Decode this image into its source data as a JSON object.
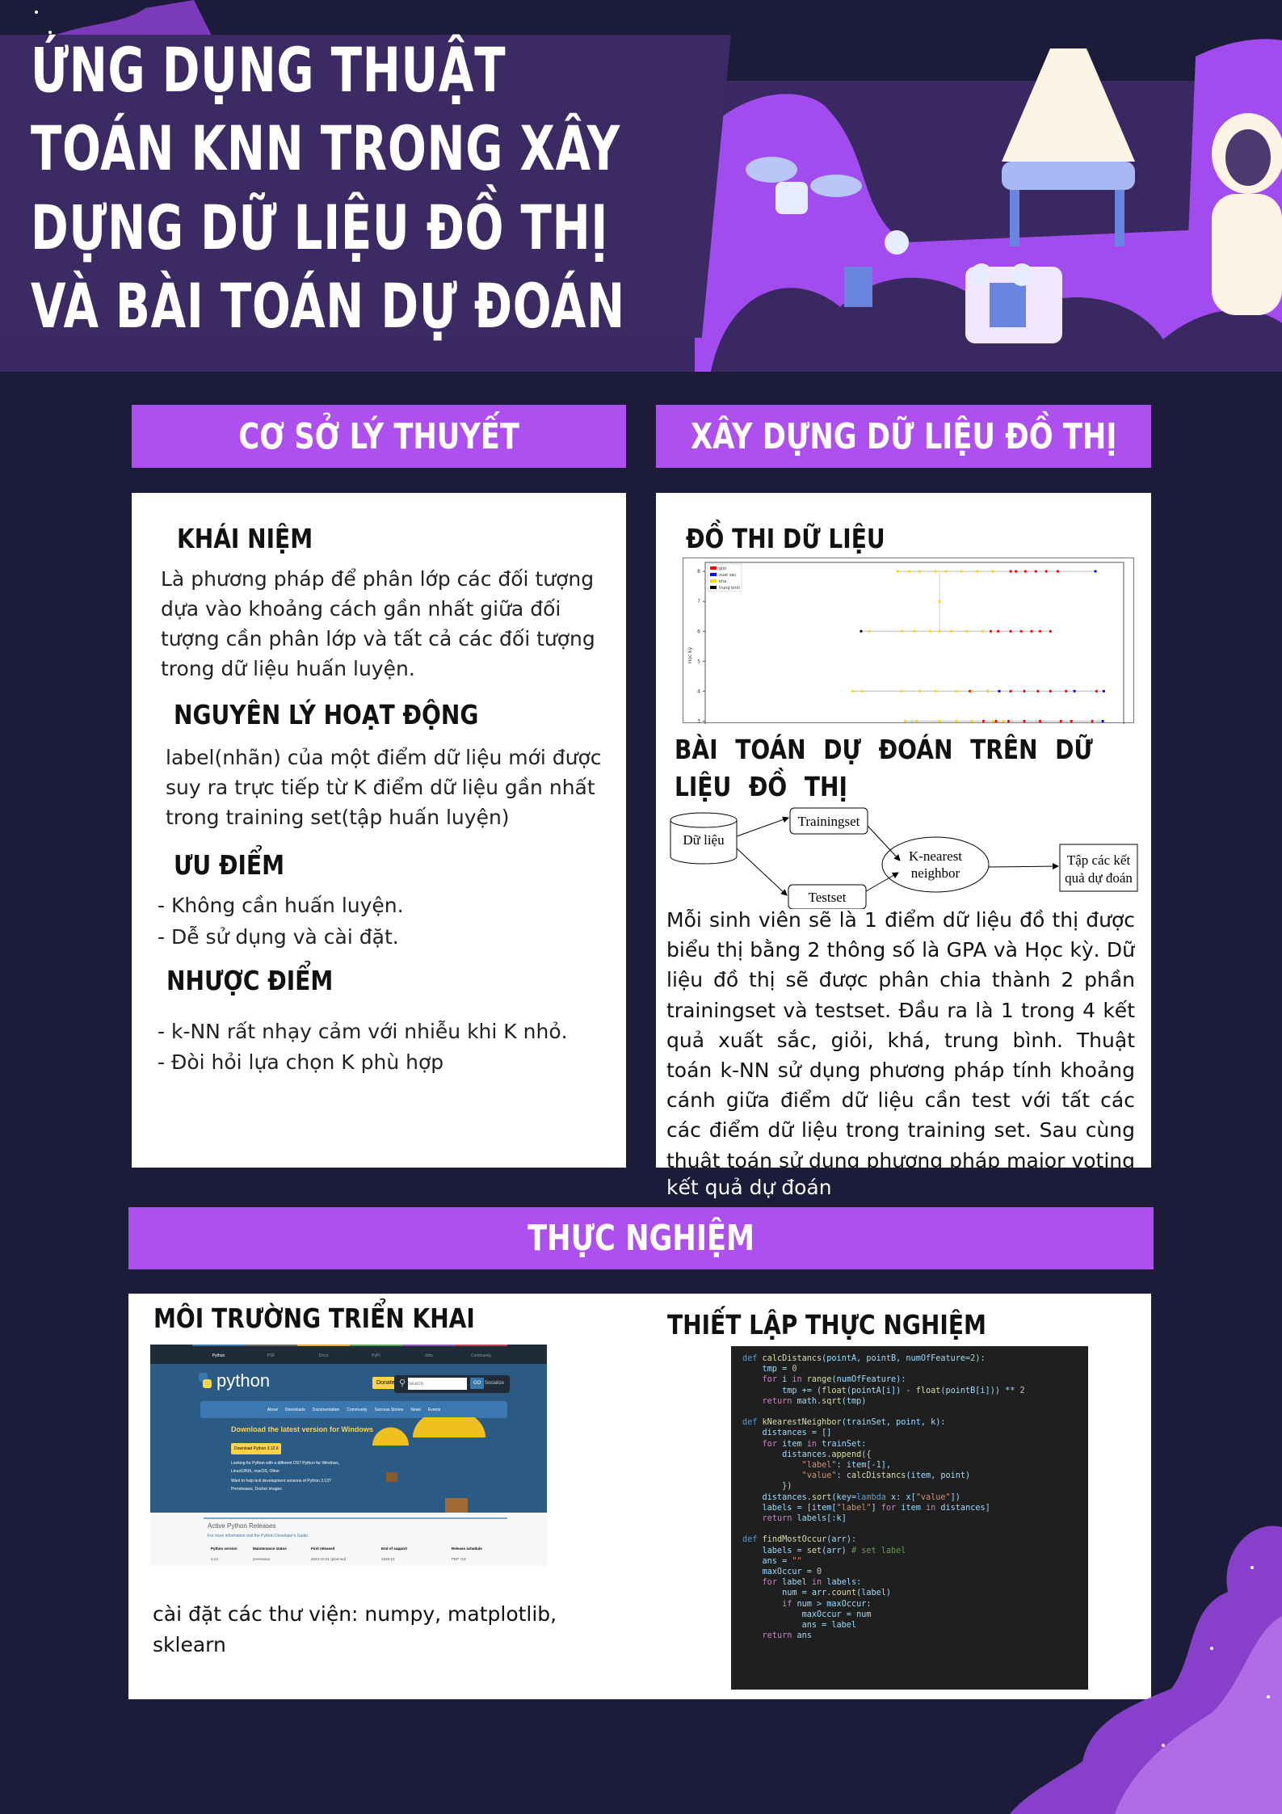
{
  "title": {
    "lines": [
      "Ứng dụng thuật",
      "toán KNN trong xây",
      "dựng dữ liệu đồ thị",
      "và bài toán dự đoán"
    ]
  },
  "colors": {
    "background": "#1c1b39",
    "accent": "#ae4ff0",
    "header_band": "#3b2a63",
    "panel": "#ffffff"
  },
  "theory": {
    "header": "Cơ  sở lý thuyết",
    "concept": {
      "heading": "Khái niệm",
      "text": "Là phương pháp để phân lớp các đối tượng dựa vào khoảng cách gần nhất giữa đối tượng cần phân lớp và tất cả các đối tượng trong dữ liệu huấn luyện."
    },
    "principle": {
      "heading": "Nguyên lý hoạt động",
      "text": "label(nhãn) của một điểm dữ liệu mới được suy ra trực tiếp từ K điểm dữ liệu gần nhất trong training set(tập huấn luyện)"
    },
    "pros": {
      "heading": "Ưu điểm",
      "items": [
        "- Không cần huấn luyện.",
        "- Dễ sử dụng và cài đặt."
      ]
    },
    "cons": {
      "heading": "Nhược điểm",
      "items": [
        "- k-NN rất nhạy cảm với nhiễu khi K nhỏ.",
        "- Đòi hỏi lựa chọn K phù hợp"
      ]
    }
  },
  "graph": {
    "header": "Xây dựng dữ liệu đồ thị",
    "chart_heading": "Đồ thi dữ liệu",
    "problem_heading": "Bài toán dự đoán trên dữ liệu đồ thị",
    "diagram": {
      "data": "Dữ liệu",
      "train": "Trainingset",
      "test": "Testset",
      "knn_line1": "K-nearest",
      "knn_line2": "neighbor",
      "out_line1": "Tập các kết",
      "out_line2": "quả dự đoán"
    },
    "body": "Mỗi sinh viên sẽ là 1 điểm dữ liệu đồ thị được biểu thị bằng 2 thông số là GPA và Học kỳ. Dữ liệu đồ thị sẽ được phân chia thành 2 phần trainingset và testset. Đầu ra là 1 trong 4 kết quả xuất sắc, giỏi, khá, trung bình. Thuật toán k-NN sử dụng phương pháp tính khoảng cánh giữa điểm dữ liệu cần test với tất các các điểm dữ liệu trong training set. Sau cùng thuật toán sử dụng phương pháp major voting để cho ra",
    "body_overflow": "kết quả dự đoán"
  },
  "chart_data": {
    "type": "scatter",
    "ylabel": "Học kỳ",
    "yticks": [
      "3",
      "4",
      "5",
      "6",
      "7",
      "8"
    ],
    "ylim": [
      2.5,
      8.3
    ],
    "xlim": [
      0,
      4
    ],
    "legend_position": "top-left",
    "series": [
      {
        "name": "gioi",
        "color": "#ff0000",
        "points": [
          [
            2.92,
            8
          ],
          [
            2.97,
            8
          ],
          [
            3.06,
            8
          ],
          [
            3.16,
            8
          ],
          [
            3.26,
            8
          ],
          [
            3.37,
            8
          ],
          [
            2.73,
            6
          ],
          [
            2.8,
            6
          ],
          [
            2.92,
            6
          ],
          [
            3.02,
            6
          ],
          [
            3.12,
            6
          ],
          [
            3.2,
            6
          ],
          [
            3.3,
            6
          ],
          [
            2.53,
            4
          ],
          [
            2.7,
            4
          ],
          [
            2.92,
            4
          ],
          [
            3.05,
            4
          ],
          [
            3.18,
            4
          ],
          [
            3.3,
            4
          ],
          [
            3.45,
            4
          ],
          [
            3.74,
            4
          ],
          [
            2.66,
            3
          ],
          [
            2.78,
            3
          ],
          [
            2.9,
            3
          ],
          [
            3.05,
            3
          ],
          [
            3.2,
            3
          ],
          [
            3.4,
            3
          ],
          [
            3.5,
            3
          ],
          [
            3.7,
            3
          ]
        ]
      },
      {
        "name": "xuat sac",
        "color": "#0000ff",
        "points": [
          [
            3.73,
            8
          ],
          [
            2.81,
            4
          ],
          [
            3.53,
            4
          ],
          [
            3.81,
            4
          ],
          [
            3.8,
            3
          ]
        ]
      },
      {
        "name": "kha",
        "color": "#ffd700",
        "points": [
          [
            1.84,
            8
          ],
          [
            1.95,
            8
          ],
          [
            2.05,
            8
          ],
          [
            2.2,
            8
          ],
          [
            2.3,
            8
          ],
          [
            2.45,
            8
          ],
          [
            2.6,
            8
          ],
          [
            2.75,
            8
          ],
          [
            2.24,
            7
          ],
          [
            1.57,
            6
          ],
          [
            1.88,
            6
          ],
          [
            2.0,
            6
          ],
          [
            2.15,
            6
          ],
          [
            2.24,
            6
          ],
          [
            2.35,
            6
          ],
          [
            2.5,
            6
          ],
          [
            2.65,
            6
          ],
          [
            1.41,
            4
          ],
          [
            1.5,
            4
          ],
          [
            1.88,
            4
          ],
          [
            2.05,
            4
          ],
          [
            2.2,
            4
          ],
          [
            2.4,
            4
          ],
          [
            2.55,
            4
          ],
          [
            2.7,
            4
          ],
          [
            1.91,
            3
          ],
          [
            2.02,
            3
          ],
          [
            2.24,
            3
          ],
          [
            2.4,
            3
          ],
          [
            2.55,
            3
          ],
          [
            2.75,
            3
          ],
          [
            2.85,
            3
          ]
        ]
      },
      {
        "name": "trung binh",
        "color": "#000000",
        "points": [
          [
            1.49,
            6
          ]
        ]
      }
    ]
  },
  "experiment": {
    "header": "Thực nghiệm",
    "env_heading": "Môi trường triển khai",
    "libs_line1": "cài đặt các thư viện: numpy, matplotlib,",
    "libs_line2": "sklearn",
    "setup_heading": "Thiết lập thực nghiệm",
    "python_site": {
      "top_tabs": [
        "Python",
        "PSF",
        "Docs",
        "PyPI",
        "Jobs",
        "Community"
      ],
      "logo": "python",
      "donate": "Donate",
      "search_placeholder": "Search",
      "go": "GO",
      "socialize": "Socialize",
      "nav": [
        "About",
        "Downloads",
        "Documentation",
        "Community",
        "Success Stories",
        "News",
        "Events"
      ],
      "download_title": "Download the latest version for Windows",
      "download_button": "Download Python 3.12.6",
      "other_os": "Looking for Python with a different OS? Python for Windows, Linux/UNIX, macOS, Other",
      "prerelease": "Want to help test development versions of Python 3.13? Prereleases, Docker images",
      "releases_title": "Active Python Releases",
      "releases_sub": "For more information visit the Python Developer's Guide.",
      "table_headers": [
        "Python version",
        "Maintenance status",
        "First released",
        "End of support",
        "Release schedule"
      ],
      "table_row": [
        "3.13",
        "prerelease",
        "2024-10-01 (planned)",
        "2029-10",
        "PEP 719"
      ]
    },
    "code": [
      "def calcDistancs(pointA, pointB, numOfFeature=2):",
      "    tmp = 0",
      "    for i in range(numOfFeature):",
      "        tmp += (float(pointA[i]) - float(pointB[i])) ** 2",
      "    return math.sqrt(tmp)",
      "",
      "def kNearestNeighbor(trainSet, point, k):",
      "    distances = []",
      "    for item in trainSet:",
      "        distances.append({",
      "            \"label\": item[-1],",
      "            \"value\": calcDistancs(item, point)",
      "        })",
      "    distances.sort(key=lambda x: x[\"value\"])",
      "    labels = [item[\"label\"] for item in distances]",
      "    return labels[:k]",
      "",
      "def findMostOccur(arr):",
      "    labels = set(arr) # set label",
      "    ans = \"\"",
      "    maxOccur = 0",
      "    for label in labels:",
      "        num = arr.count(label)",
      "        if num > maxOccur:",
      "            maxOccur = num",
      "            ans = label",
      "    return ans"
    ]
  }
}
